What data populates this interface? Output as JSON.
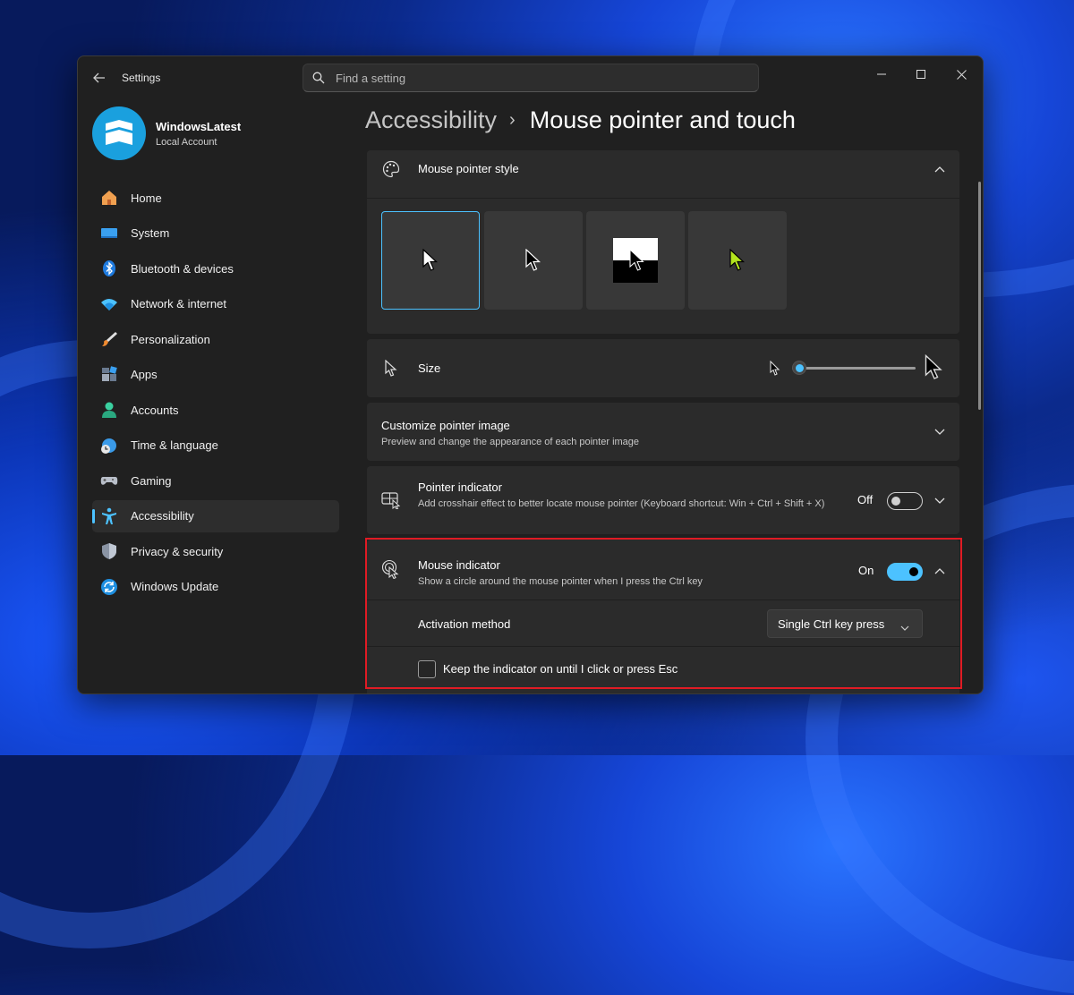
{
  "titlebar": {
    "app_title": "Settings",
    "search_placeholder": "Find a setting"
  },
  "profile": {
    "name": "WindowsLatest",
    "account_type": "Local Account"
  },
  "sidebar": {
    "items": [
      {
        "label": "Home",
        "icon": "home-icon",
        "active": false
      },
      {
        "label": "System",
        "icon": "monitor-icon",
        "active": false
      },
      {
        "label": "Bluetooth & devices",
        "icon": "bluetooth-icon",
        "active": false
      },
      {
        "label": "Network & internet",
        "icon": "wifi-icon",
        "active": false
      },
      {
        "label": "Personalization",
        "icon": "paintbrush-icon",
        "active": false
      },
      {
        "label": "Apps",
        "icon": "apps-icon",
        "active": false
      },
      {
        "label": "Accounts",
        "icon": "person-icon",
        "active": false
      },
      {
        "label": "Time & language",
        "icon": "globe-clock-icon",
        "active": false
      },
      {
        "label": "Gaming",
        "icon": "gamepad-icon",
        "active": false
      },
      {
        "label": "Accessibility",
        "icon": "accessibility-icon",
        "active": true
      },
      {
        "label": "Privacy & security",
        "icon": "shield-icon",
        "active": false
      },
      {
        "label": "Windows Update",
        "icon": "update-icon",
        "active": false
      }
    ]
  },
  "breadcrumb": {
    "parent": "Accessibility",
    "separator": "›",
    "current": "Mouse pointer and touch"
  },
  "pointer_style": {
    "title": "Mouse pointer style",
    "options": [
      "white",
      "black",
      "inverted",
      "custom-lime"
    ],
    "selected": "white",
    "custom_color": "#b4e61e"
  },
  "size": {
    "title": "Size",
    "value_fraction": 0.0
  },
  "customize": {
    "title": "Customize pointer image",
    "description": "Preview and change the appearance of each pointer image"
  },
  "pointer_indicator": {
    "title": "Pointer indicator",
    "description": "Add crosshair effect to better locate mouse pointer (Keyboard shortcut: Win + Ctrl + Shift + X)",
    "state_label": "Off",
    "enabled": false
  },
  "mouse_indicator": {
    "title": "Mouse indicator",
    "description": "Show a circle around the mouse pointer when I press the Ctrl key",
    "state_label": "On",
    "enabled": true,
    "activation_label": "Activation method",
    "activation_value": "Single Ctrl key press",
    "keep_on_label": "Keep the indicator on until I click or press Esc",
    "keep_on_checked": false
  },
  "colors": {
    "accent": "#4cc2ff",
    "highlight_border": "#e01b24",
    "window_bg": "#202020",
    "card_bg": "#2b2b2b"
  }
}
